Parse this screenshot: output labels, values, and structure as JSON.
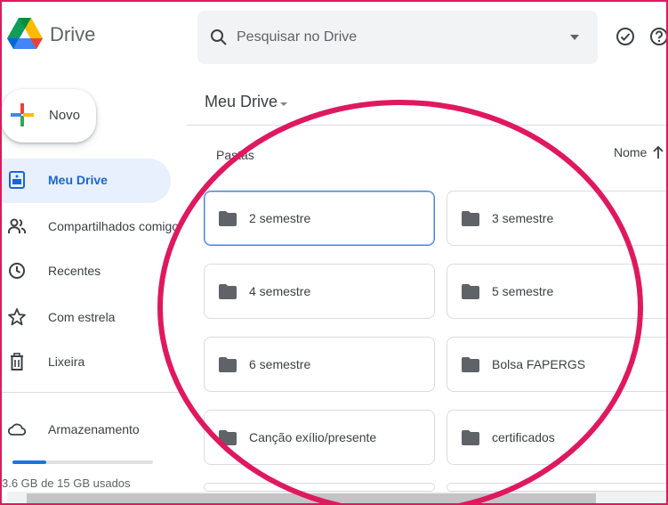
{
  "header": {
    "app_title": "Drive",
    "search_placeholder": "Pesquisar no Drive",
    "icons": [
      "drive-logo",
      "search-icon",
      "dropdown-icon",
      "offline-check-icon",
      "help-icon"
    ]
  },
  "sidebar": {
    "new_button": "Novo",
    "items": [
      {
        "label": "Meu Drive",
        "icon": "my-drive-icon",
        "active": true
      },
      {
        "label": "Compartilhados comigo",
        "icon": "shared-icon",
        "active": false
      },
      {
        "label": "Recentes",
        "icon": "clock-icon",
        "active": false
      },
      {
        "label": "Com estrela",
        "icon": "star-icon",
        "active": false
      },
      {
        "label": "Lixeira",
        "icon": "trash-icon",
        "active": false
      }
    ],
    "storage_label": "Armazenamento",
    "storage_used_fraction": 0.24,
    "storage_usage": "3.6 GB de 15 GB usados"
  },
  "main": {
    "title": "Meu Drive",
    "section": "Pastas",
    "sort_label": "Nome",
    "folders": [
      {
        "name": "2 semestre",
        "selected": true
      },
      {
        "name": "3 semestre",
        "selected": false
      },
      {
        "name": "4 semestre",
        "selected": false
      },
      {
        "name": "5 semestre",
        "selected": false
      },
      {
        "name": "6 semestre",
        "selected": false
      },
      {
        "name": "Bolsa FAPERGS",
        "selected": false
      },
      {
        "name": "Canção exílio/presente",
        "selected": false
      },
      {
        "name": "certificados",
        "selected": false
      }
    ]
  },
  "colors": {
    "annotation": "#e0185e",
    "active_bg": "#e8f0fe",
    "active_text": "#1967d2",
    "accent": "#1a73e8"
  }
}
